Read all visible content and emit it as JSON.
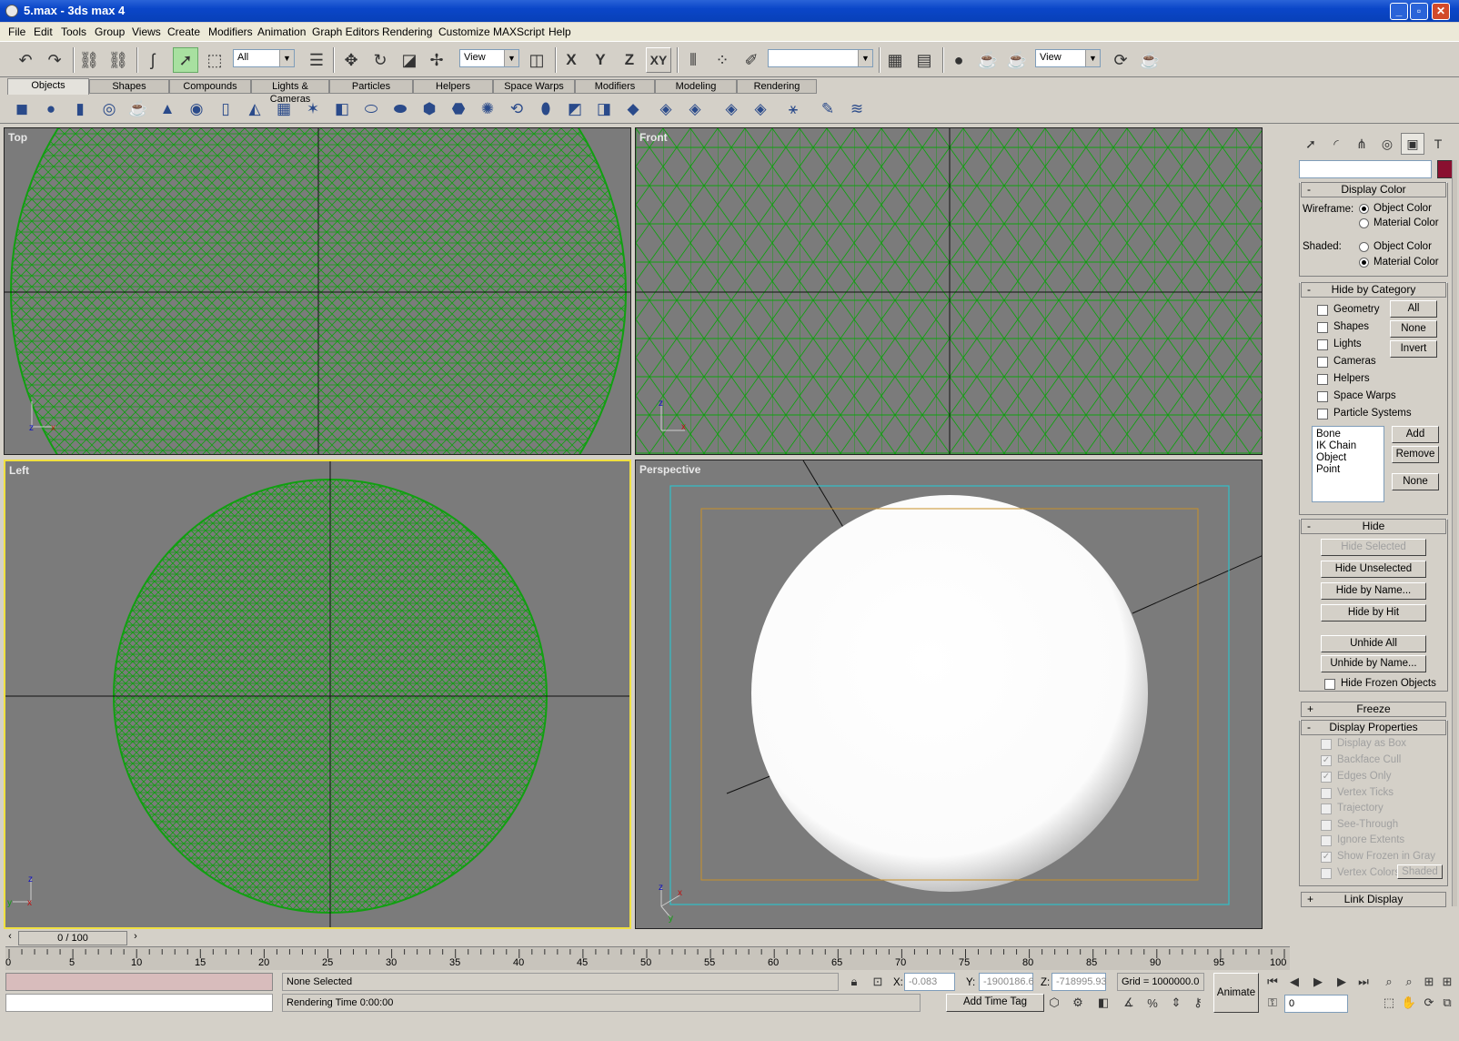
{
  "window": {
    "title": "5.max - 3ds max 4"
  },
  "menu": [
    "File",
    "Edit",
    "Tools",
    "Group",
    "Views",
    "Create",
    "Modifiers",
    "Animation",
    "Graph Editors",
    "Rendering",
    "Customize",
    "MAXScript",
    "Help"
  ],
  "toolbar": {
    "selection_filter": "All",
    "ref_coord": "View",
    "axis_x": "X",
    "axis_y": "Y",
    "axis_z": "Z",
    "axis_xy": "XY",
    "named_selection": "",
    "render_view": "View"
  },
  "tabs": [
    "Objects",
    "Shapes",
    "Compounds",
    "Lights & Cameras",
    "Particles",
    "Helpers",
    "Space Warps",
    "Modifiers",
    "Modeling",
    "Rendering"
  ],
  "viewports": {
    "top": "Top",
    "front": "Front",
    "left": "Left",
    "perspective": "Perspective"
  },
  "panel": {
    "display_color": {
      "title": "Display Color",
      "wireframe_label": "Wireframe:",
      "shaded_label": "Shaded:",
      "object_color": "Object Color",
      "material_color": "Material Color"
    },
    "hide_by_category": {
      "title": "Hide by Category",
      "items": [
        "Geometry",
        "Shapes",
        "Lights",
        "Cameras",
        "Helpers",
        "Space Warps",
        "Particle Systems"
      ],
      "all": "All",
      "none": "None",
      "invert": "Invert",
      "list": [
        "Bone",
        "IK Chain Object",
        "Point"
      ],
      "add": "Add",
      "remove": "Remove",
      "none2": "None"
    },
    "hide": {
      "title": "Hide",
      "hide_selected": "Hide Selected",
      "hide_unselected": "Hide Unselected",
      "hide_by_name": "Hide by Name...",
      "hide_by_hit": "Hide by Hit",
      "unhide_all": "Unhide All",
      "unhide_by_name": "Unhide by Name...",
      "hide_frozen": "Hide Frozen Objects"
    },
    "freeze": {
      "title": "Freeze"
    },
    "display_properties": {
      "title": "Display Properties",
      "items": [
        "Display as Box",
        "Backface Cull",
        "Edges Only",
        "Vertex Ticks",
        "Trajectory",
        "See-Through",
        "Ignore Extents",
        "Show Frozen in Gray",
        "Vertex Colors"
      ],
      "shaded_btn": "Shaded"
    },
    "link_display": {
      "title": "Link Display"
    },
    "minus": "-",
    "plus": "+"
  },
  "timeline": {
    "slider": "0 / 100",
    "ticks": [
      "0",
      "5",
      "10",
      "15",
      "20",
      "25",
      "30",
      "35",
      "40",
      "45",
      "50",
      "55",
      "60",
      "65",
      "70",
      "75",
      "80",
      "85",
      "90",
      "95",
      "100"
    ]
  },
  "status": {
    "selection": "None Selected",
    "rendering_time": "Rendering Time  0:00:00",
    "x_label": "X:",
    "x_value": "-0.083",
    "y_label": "Y:",
    "y_value": "-1900186.6",
    "z_label": "Z:",
    "z_value": "-718995.93",
    "grid": "Grid = 1000000.0",
    "add_time_tag": "Add Time Tag",
    "animate": "Animate",
    "frame": "0"
  }
}
